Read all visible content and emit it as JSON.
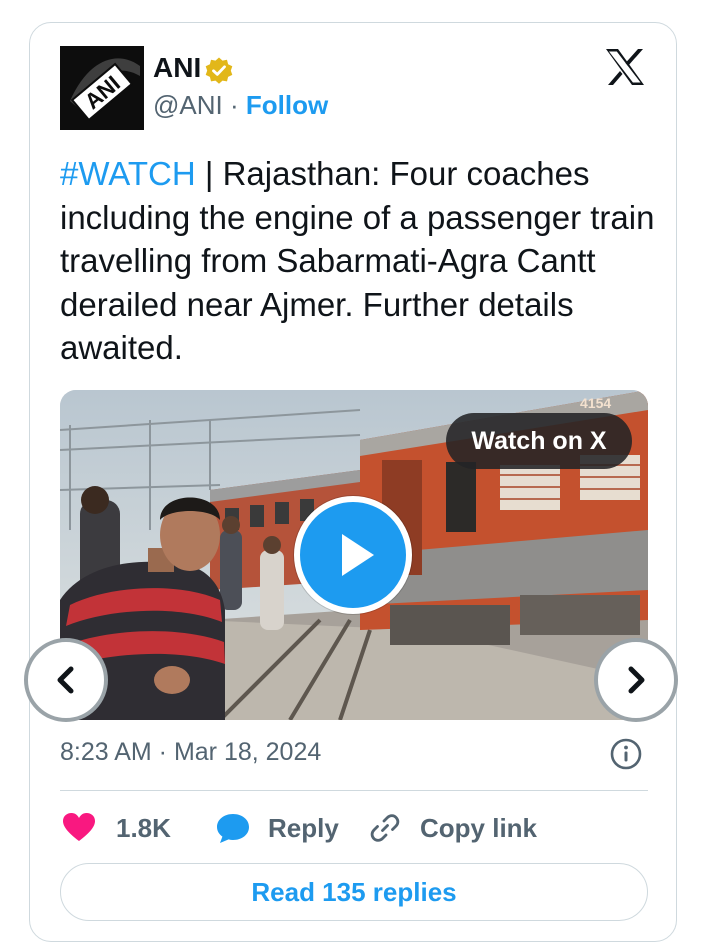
{
  "author": {
    "name": "ANI",
    "handle": "@ANI",
    "separator": " · ",
    "follow_label": "Follow",
    "avatar_text": "ANI",
    "avatar_icon": "ani-logo",
    "verified_icon": "verified-gold-badge-icon"
  },
  "platform_icon": "x-logo-icon",
  "tweet": {
    "hashtag": "#WATCH",
    "text": " | Rajasthan: Four coaches including the engine of a passenger train travelling from Sabarmati-Agra Cantt derailed near Ajmer. Further details awaited."
  },
  "media": {
    "watch_label": "Watch on X",
    "play_icon": "play-icon",
    "coach_number_text": "4154"
  },
  "navigation": {
    "prev_icon": "chevron-left-icon",
    "next_icon": "chevron-right-icon"
  },
  "meta": {
    "timestamp": "8:23 AM · Mar 18, 2024",
    "info_icon": "info-icon"
  },
  "actions": {
    "likes": "1.8K",
    "reply_label": "Reply",
    "copy_link_label": "Copy link"
  },
  "read_replies_label": "Read 135 replies",
  "colors": {
    "accent": "#1d9bf0",
    "like": "#f91880",
    "text": "#0f1419",
    "muted": "#536471",
    "border": "#cfd9de",
    "verified": "#e2b719"
  }
}
